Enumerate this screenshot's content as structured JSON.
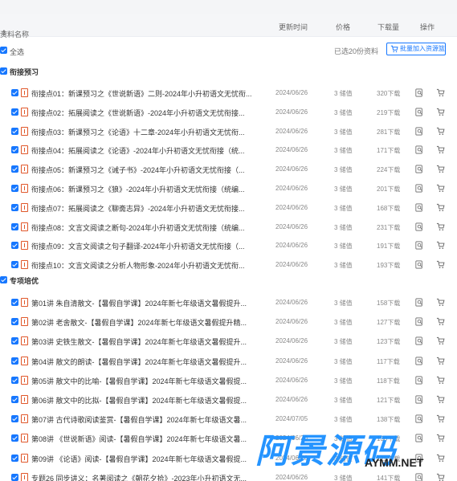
{
  "header": {
    "name_label": "资料名称",
    "time_label": "更新时间",
    "price_label": "价格",
    "download_label": "下载量",
    "operation_label": "操作"
  },
  "selectbar": {
    "select_all_label": "全选",
    "selected_count": "已选20份资料",
    "batch_button_label": "批量加入资源篮"
  },
  "sections": [
    {
      "title": "衔接预习",
      "rows": [
        {
          "title": "衔接点01：新课预习之《世说新语》二则-2024年小升初语文无忧衔...",
          "date": "2024/06/26",
          "price": "3 储值",
          "downloads": "320下载"
        },
        {
          "title": "衔接点02：拓展阅读之《世说新语》-2024年小升初语文无忧衔接...",
          "date": "2024/06/26",
          "price": "3 储值",
          "downloads": "219下载"
        },
        {
          "title": "衔接点03：新课预习之《论语》十二章-2024年小升初语文无忧衔...",
          "date": "2024/06/26",
          "price": "3 储值",
          "downloads": "281下载"
        },
        {
          "title": "衔接点04：拓展阅读之《论语》-2024年小升初语文无忧衔接（统...",
          "date": "2024/06/26",
          "price": "3 储值",
          "downloads": "171下载"
        },
        {
          "title": "衔接点05：新课预习之《诫子书》-2024年小升初语文无忧衔接（...",
          "date": "2024/06/26",
          "price": "3 储值",
          "downloads": "224下载"
        },
        {
          "title": "衔接点06：新课预习之《狼》-2024年小升初语文无忧衔接（统编...",
          "date": "2024/06/26",
          "price": "3 储值",
          "downloads": "201下载"
        },
        {
          "title": "衔接点07：拓展阅读之《聊斋志异》-2024年小升初语文无忧衔接...",
          "date": "2024/06/26",
          "price": "3 储值",
          "downloads": "168下载"
        },
        {
          "title": "衔接点08：文言文阅读之断句-2024年小升初语文无忧衔接（统编...",
          "date": "2024/06/26",
          "price": "3 储值",
          "downloads": "231下载"
        },
        {
          "title": "衔接点09：文言文阅读之句子翻译-2024年小升初语文无忧衔接（...",
          "date": "2024/06/26",
          "price": "3 储值",
          "downloads": "191下载"
        },
        {
          "title": "衔接点10：文言文阅读之分析人物形象-2024年小升初语文无忧衔...",
          "date": "2024/06/26",
          "price": "3 储值",
          "downloads": "193下载"
        }
      ]
    },
    {
      "title": "专项培优",
      "rows": [
        {
          "title": "第01讲 朱自清散文-【暑假自学课】2024年新七年级语文暑假提升...",
          "date": "2024/06/26",
          "price": "3 储值",
          "downloads": "158下载"
        },
        {
          "title": "第02讲 老舍散文-【暑假自学课】2024年新七年级语文暑假提升精...",
          "date": "2024/06/26",
          "price": "3 储值",
          "downloads": "127下载"
        },
        {
          "title": "第03讲 史铁生散文-【暑假自学课】2024年新七年级语文暑假提升...",
          "date": "2024/06/26",
          "price": "3 储值",
          "downloads": "123下载"
        },
        {
          "title": "第04讲 散文的朗读-【暑假自学课】2024年新七年级语文暑假提升...",
          "date": "2024/06/26",
          "price": "3 储值",
          "downloads": "117下载"
        },
        {
          "title": "第05讲 散文中的比喻-【暑假自学课】2024年新七年级语文暑假提...",
          "date": "2024/06/26",
          "price": "3 储值",
          "downloads": "118下载"
        },
        {
          "title": "第06讲 散文中的比拟-【暑假自学课】2024年新七年级语文暑假提...",
          "date": "2024/06/26",
          "price": "3 储值",
          "downloads": "121下载"
        },
        {
          "title": "第07讲 古代诗歌阅读鉴赏-【暑假自学课】2024年新七年级语文暑...",
          "date": "2024/07/05",
          "price": "3 储值",
          "downloads": "138下载"
        },
        {
          "title": "第08讲 《世说新语》阅读-【暑假自学课】2024年新七年级语文暑...",
          "date": "2024/06/26",
          "price": "3 储值",
          "downloads": "130下载"
        },
        {
          "title": "第09讲 《论语》阅读-【暑假自学课】2024年新七年级语文暑假提...",
          "date": "2024/06/26",
          "price": "3 储值",
          "downloads": "125下载"
        },
        {
          "title": "专题26 同步讲义：名著阅读之《朝花夕拾》-2023年小升初语文无...",
          "date": "2024/06/26",
          "price": "3 储值",
          "downloads": "141下载"
        }
      ]
    }
  ],
  "watermark": {
    "text": "阿景源码",
    "url": "AYMM.NET"
  },
  "colors": {
    "accent": "#1677ff",
    "file_icon": "#e0572a",
    "watermark": "#1a8fff"
  }
}
